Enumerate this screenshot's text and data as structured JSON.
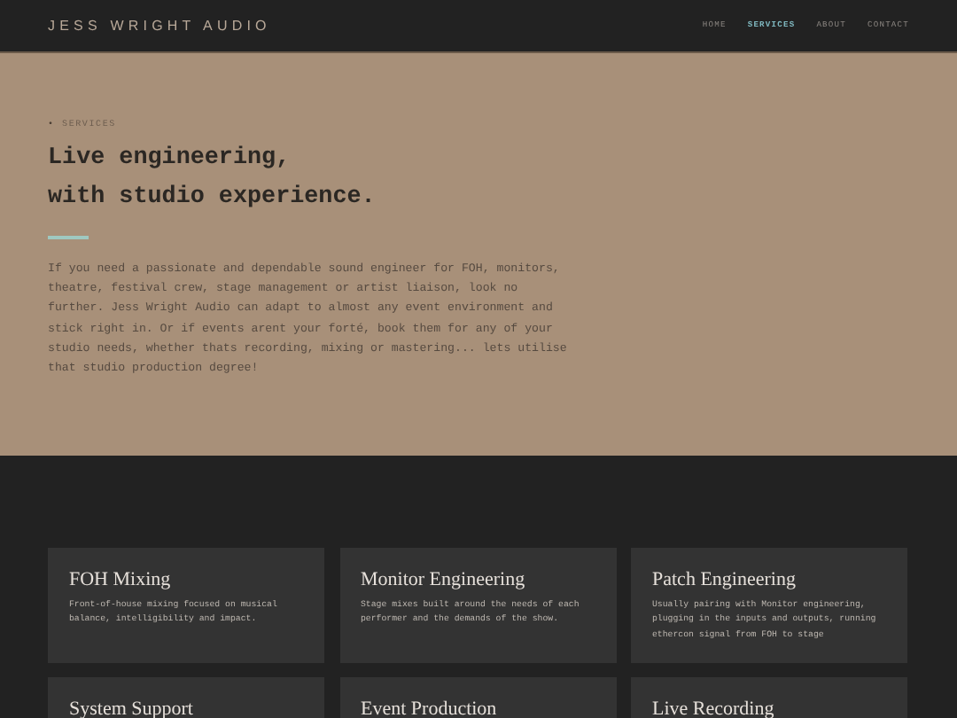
{
  "header": {
    "logo": "JESS WRIGHT AUDIO",
    "nav": [
      {
        "label": "HOME",
        "selected": false
      },
      {
        "label": "SERVICES",
        "selected": true
      },
      {
        "label": "ABOUT",
        "selected": false
      },
      {
        "label": "CONTACT",
        "selected": false
      }
    ]
  },
  "hero": {
    "eyebrow_marker": "•",
    "eyebrow": "SERVICES",
    "heading_lines": [
      "Live engineering,",
      "with studio experience."
    ],
    "paragraph": "If you need a passionate and dependable sound engineer for FOH, monitors, theatre, festival crew, stage management or artist liaison, look no further. Jess Wright Audio can adapt to almost any event environment and stick right in. Or if events arent your forté, book them for any of your studio needs, whether thats recording, mixing or mastering... lets utilise that studio production degree!"
  },
  "services": [
    {
      "title": "FOH Mixing",
      "description": "Front-of-house mixing focused on musical balance, intelligibility and impact."
    },
    {
      "title": "Monitor Engineering",
      "description": "Stage mixes built around the needs of each performer and the demands of the show."
    },
    {
      "title": "Patch Engineering",
      "description": "Usually pairing with Monitor engineering, plugging in the inputs and outputs, running ethercon signal from FOH to stage"
    },
    {
      "title": "System Support"
    },
    {
      "title": "Event Production"
    },
    {
      "title": "Live Recording"
    }
  ]
}
